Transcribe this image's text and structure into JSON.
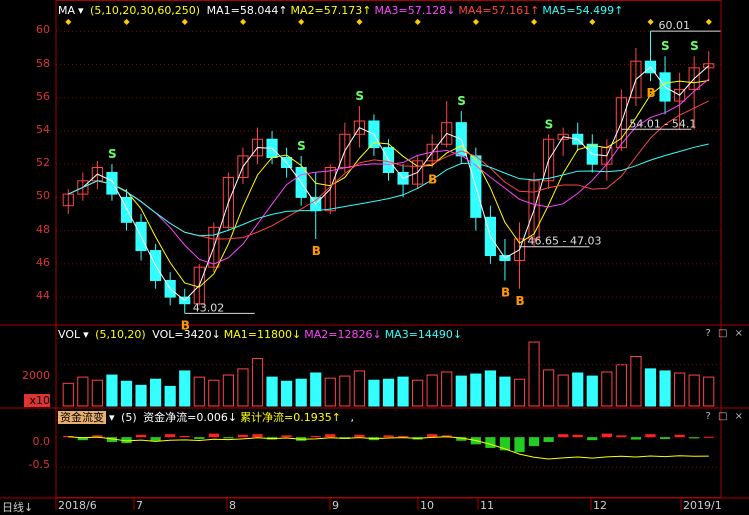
{
  "header_main": {
    "indicator": "MA",
    "params": "(5,10,20,30,60,250)",
    "items": [
      {
        "label": "MA1=58.044",
        "color": "#ffffff",
        "arrow": "↑"
      },
      {
        "label": "MA2=57.173",
        "color": "#ffff00",
        "arrow": "↑"
      },
      {
        "label": "MA3=57.128",
        "color": "#ff44ff",
        "arrow": "↓"
      },
      {
        "label": "MA4=57.161",
        "color": "#ff4444",
        "arrow": "↑"
      },
      {
        "label": "MA5=54.499",
        "color": "#33ffff",
        "arrow": "↑"
      }
    ]
  },
  "header_vol": {
    "indicator": "VOL",
    "params": "(5,10,20)",
    "items": [
      {
        "label": "VOL=3420",
        "color": "#ffffff",
        "arrow": "↓"
      },
      {
        "label": "MA1=11800",
        "color": "#ffff00",
        "arrow": "↓"
      },
      {
        "label": "MA2=12826",
        "color": "#ff44ff",
        "arrow": "↓"
      },
      {
        "label": "MA3=14490",
        "color": "#33ffff",
        "arrow": "↓"
      }
    ]
  },
  "header_flow": {
    "indicator": "资金流变",
    "params": "(5)",
    "items": [
      {
        "label": "资金净流=0.006",
        "color": "#ffffff",
        "arrow": "↓"
      },
      {
        "label": "累计净流=0.1935",
        "color": "#ffff00",
        "arrow": "↑"
      }
    ],
    "tail": ","
  },
  "panel_controls": "? □ ×",
  "period_label": "日线",
  "x_labels": [
    "2018/6",
    "7",
    "8",
    "9",
    "10",
    "11",
    "12",
    "2019/1"
  ],
  "vol_axis": {
    "tick": "2000",
    "unit": "x10"
  },
  "flow_axis": {
    "ticks": [
      "0.0",
      "-0.5"
    ]
  },
  "colors": {
    "up": "#ff4444",
    "down": "#33ffff",
    "ma1": "#ffffff",
    "ma2": "#ffff00",
    "ma3": "#ff44ff",
    "ma4": "#ff4444",
    "ma5": "#33ffff",
    "grid": "#8b0000"
  },
  "chart_data": [
    {
      "type": "candlestick",
      "ylim": [
        42.5,
        60.8
      ],
      "yticks": [
        44,
        46,
        48,
        50,
        52,
        54,
        56,
        58,
        60
      ],
      "ohlc_sampled": [
        [
          49.5,
          50.5,
          49.0,
          50.2
        ],
        [
          50.2,
          51.5,
          49.8,
          51.0
        ],
        [
          51.0,
          52.2,
          50.5,
          51.8
        ],
        [
          51.5,
          52.0,
          49.8,
          50.2
        ],
        [
          50.0,
          50.5,
          48.0,
          48.5
        ],
        [
          48.5,
          49.0,
          46.2,
          46.8
        ],
        [
          46.8,
          47.2,
          44.5,
          45.0
        ],
        [
          45.0,
          45.5,
          43.5,
          44.0
        ],
        [
          44.0,
          44.5,
          43.02,
          43.6
        ],
        [
          43.6,
          46.0,
          43.5,
          45.8
        ],
        [
          45.8,
          48.5,
          45.5,
          48.2
        ],
        [
          48.2,
          51.5,
          48.0,
          51.2
        ],
        [
          51.2,
          53.0,
          50.8,
          52.5
        ],
        [
          52.5,
          54.2,
          52.0,
          53.5
        ],
        [
          53.5,
          54.0,
          52.0,
          52.4
        ],
        [
          52.4,
          53.0,
          51.2,
          51.8
        ],
        [
          51.8,
          52.5,
          49.5,
          50.0
        ],
        [
          50.0,
          51.5,
          47.5,
          49.2
        ],
        [
          49.2,
          52.0,
          49.0,
          51.8
        ],
        [
          51.8,
          54.5,
          51.5,
          53.8
        ],
        [
          53.8,
          55.5,
          53.0,
          54.6
        ],
        [
          54.6,
          55.0,
          52.5,
          53.0
        ],
        [
          53.0,
          53.5,
          51.0,
          51.5
        ],
        [
          51.5,
          52.0,
          50.0,
          50.8
        ],
        [
          50.8,
          52.5,
          50.5,
          52.2
        ],
        [
          52.2,
          53.8,
          51.8,
          53.2
        ],
        [
          53.2,
          55.8,
          53.0,
          54.5
        ],
        [
          54.5,
          55.2,
          52.0,
          52.5
        ],
        [
          52.5,
          53.0,
          48.0,
          48.8
        ],
        [
          48.8,
          49.5,
          46.0,
          46.5
        ],
        [
          46.5,
          47.5,
          45.0,
          46.2
        ],
        [
          46.2,
          48.5,
          44.5,
          47.5
        ],
        [
          47.5,
          51.5,
          47.0,
          51.0
        ],
        [
          51.0,
          53.8,
          50.5,
          53.5
        ],
        [
          53.5,
          54.2,
          52.5,
          53.8
        ],
        [
          53.8,
          54.5,
          52.8,
          53.2
        ],
        [
          53.2,
          53.8,
          51.5,
          52.0
        ],
        [
          52.0,
          53.5,
          51.0,
          53.0
        ],
        [
          53.0,
          56.5,
          52.8,
          56.0
        ],
        [
          56.0,
          59.0,
          55.5,
          58.2
        ],
        [
          58.2,
          60.01,
          57.0,
          57.5
        ],
        [
          57.5,
          58.5,
          55.0,
          55.8
        ],
        [
          55.8,
          57.5,
          54.1,
          56.5
        ],
        [
          56.5,
          58.5,
          54.1,
          57.8
        ],
        [
          57.8,
          58.8,
          57.0,
          58.044
        ]
      ],
      "signals": [
        {
          "type": "S",
          "idx": 3
        },
        {
          "type": "B",
          "idx": 8
        },
        {
          "type": "S",
          "idx": 16
        },
        {
          "type": "B",
          "idx": 17
        },
        {
          "type": "S",
          "idx": 20
        },
        {
          "type": "B",
          "idx": 25
        },
        {
          "type": "S",
          "idx": 27
        },
        {
          "type": "B",
          "idx": 30
        },
        {
          "type": "B",
          "idx": 31
        },
        {
          "type": "S",
          "idx": 33
        },
        {
          "type": "B",
          "idx": 40
        },
        {
          "type": "S",
          "idx": 41
        },
        {
          "type": "S",
          "idx": 43
        }
      ],
      "annotations": [
        {
          "text": "60.01",
          "value": 60.01,
          "idx": 40
        },
        {
          "text": "54.01 - 54.1",
          "value": 54.1,
          "idx": 38
        },
        {
          "text": "46.65 - 47.03",
          "value": 47.03,
          "idx": 31
        },
        {
          "text": "43.02",
          "value": 43.02,
          "idx": 8
        }
      ]
    },
    {
      "type": "bar",
      "name": "VOL",
      "ylim": [
        0,
        3200
      ],
      "values": [
        1100,
        1400,
        1250,
        1500,
        1200,
        1000,
        1300,
        950,
        1700,
        1400,
        1250,
        1500,
        1800,
        2300,
        1400,
        1200,
        1300,
        1600,
        1350,
        1450,
        1700,
        1250,
        1300,
        1400,
        1250,
        1500,
        1650,
        1450,
        1550,
        1700,
        1400,
        1300,
        3100,
        1750,
        1500,
        1600,
        1450,
        1650,
        2000,
        2400,
        1800,
        1700,
        1600,
        1500,
        1400
      ]
    },
    {
      "type": "bar",
      "name": "资金流变",
      "ylim": [
        -1.0,
        0.22
      ],
      "values": [
        0.02,
        -0.05,
        0.03,
        -0.08,
        -0.1,
        0.04,
        -0.06,
        0.05,
        0.02,
        -0.03,
        0.06,
        -0.02,
        0.04,
        0.05,
        -0.04,
        0.03,
        -0.06,
        0.02,
        0.05,
        -0.03,
        0.04,
        -0.05,
        0.03,
        0.02,
        -0.04,
        0.05,
        0.03,
        -0.06,
        -0.12,
        -0.18,
        -0.22,
        -0.25,
        -0.15,
        -0.08,
        0.05,
        0.04,
        -0.05,
        0.06,
        0.03,
        -0.04,
        0.05,
        -0.03,
        0.04,
        -0.02,
        0.006
      ]
    }
  ]
}
